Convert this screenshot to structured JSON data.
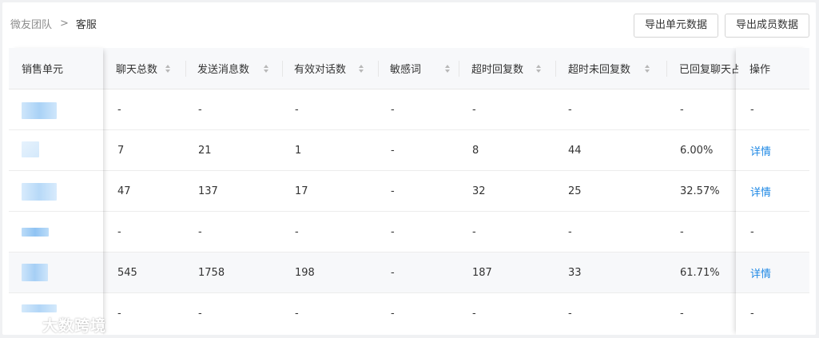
{
  "breadcrumb": {
    "parent": "微友团队",
    "separator": ">",
    "current": "客服"
  },
  "toolbar": {
    "export_unit": "导出单元数据",
    "export_member": "导出成员数据"
  },
  "table": {
    "columns": [
      {
        "label": "销售单元",
        "sortable": false
      },
      {
        "label": "聊天总数",
        "sortable": true
      },
      {
        "label": "发送消息数",
        "sortable": true
      },
      {
        "label": "有效对话数",
        "sortable": true
      },
      {
        "label": "敏感词",
        "sortable": true
      },
      {
        "label": "超时回复数",
        "sortable": true
      },
      {
        "label": "超时未回复数",
        "sortable": true
      },
      {
        "label": "已回复聊天占",
        "sortable": false
      },
      {
        "label": "操作",
        "sortable": false
      }
    ],
    "rows": [
      {
        "c1": "-",
        "c2": "-",
        "c3": "-",
        "c4": "-",
        "c5": "-",
        "c6": "-",
        "c7": "-",
        "action": "-"
      },
      {
        "c1": "7",
        "c2": "21",
        "c3": "1",
        "c4": "-",
        "c5": "8",
        "c6": "44",
        "c7": "6.00%",
        "action": "详情"
      },
      {
        "c1": "47",
        "c2": "137",
        "c3": "17",
        "c4": "-",
        "c5": "32",
        "c6": "25",
        "c7": "32.57%",
        "action": "详情"
      },
      {
        "c1": "-",
        "c2": "-",
        "c3": "-",
        "c4": "-",
        "c5": "-",
        "c6": "-",
        "c7": "-",
        "action": "-"
      },
      {
        "c1": "545",
        "c2": "1758",
        "c3": "198",
        "c4": "-",
        "c5": "187",
        "c6": "33",
        "c7": "61.71%",
        "action": "详情"
      },
      {
        "c1": "-",
        "c2": "-",
        "c3": "-",
        "c4": "-",
        "c5": "-",
        "c6": "-",
        "c7": "-",
        "action": "-"
      }
    ]
  },
  "watermark": "大数跨境",
  "colors": {
    "link": "#1e88e5",
    "header_bg": "#f7f8fa",
    "blur": "#9ecbf5"
  }
}
